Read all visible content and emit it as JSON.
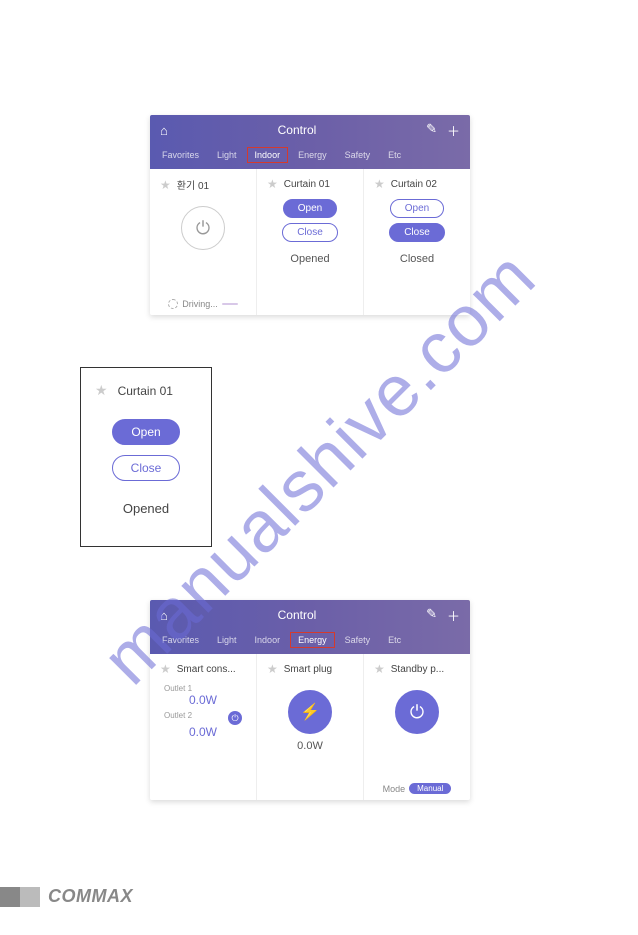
{
  "watermark": "manualshive.com",
  "screen1": {
    "title": "Control",
    "tabs": {
      "t0": "Favorites",
      "t1": "Light",
      "t2": "Indoor",
      "t3": "Energy",
      "t4": "Safety",
      "t5": "Etc"
    },
    "card0": {
      "title": "환기 01",
      "driving": "Driving...",
      "badge": ""
    },
    "card1": {
      "title": "Curtain 01",
      "open": "Open",
      "close": "Close",
      "status": "Opened"
    },
    "card2": {
      "title": "Curtain 02",
      "open": "Open",
      "close": "Close",
      "status": "Closed"
    }
  },
  "detail": {
    "title": "Curtain 01",
    "open": "Open",
    "close": "Close",
    "status": "Opened"
  },
  "screen2": {
    "title": "Control",
    "tabs": {
      "t0": "Favorites",
      "t1": "Light",
      "t2": "Indoor",
      "t3": "Energy",
      "t4": "Safety",
      "t5": "Etc"
    },
    "card0": {
      "title": "Smart cons...",
      "outlet1_label": "Outlet 1",
      "outlet1_value": "0.0W",
      "outlet2_label": "Outlet 2",
      "outlet2_value": "0.0W"
    },
    "card1": {
      "title": "Smart plug",
      "value": "0.0W"
    },
    "card2": {
      "title": "Standby  p...",
      "mode_label": "Mode",
      "mode_value": "Manual"
    }
  },
  "footer": {
    "brand": "COMMAX"
  }
}
